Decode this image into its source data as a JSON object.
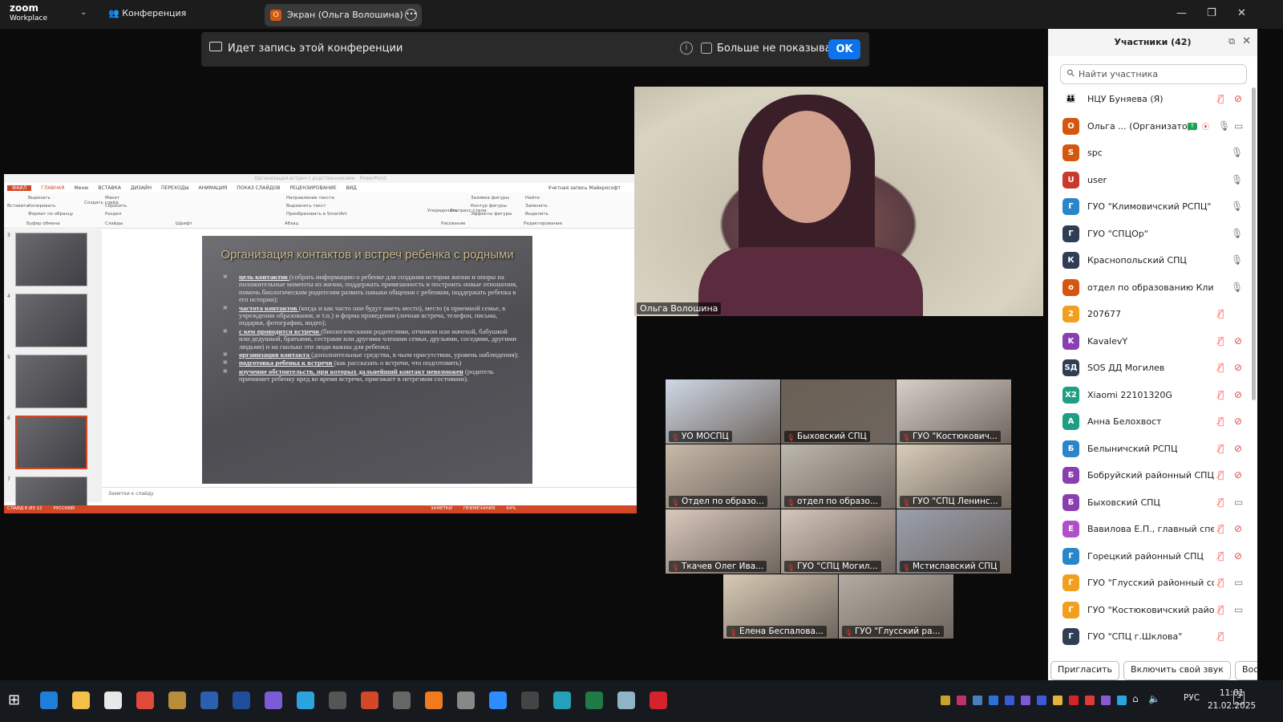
{
  "topbar": {
    "logo_line1": "zoom",
    "logo_line2": "Workplace",
    "meeting_menu": "Конференция",
    "screen_tab": "Экран (Ольга Волошина)",
    "screen_tab_initial": "О"
  },
  "banner": {
    "text": "Идет запись этой конференции",
    "dont_show": "Больше не показывать",
    "ok": "OK"
  },
  "ppt": {
    "window_title": "Организация встреч с родственниками - PowerPoint",
    "tabs": [
      "ФАЙЛ",
      "ГЛАВНАЯ",
      "Меню",
      "ВСТАВКА",
      "ДИЗАЙН",
      "ПЕРЕХОДЫ",
      "АНИМАЦИЯ",
      "ПОКАЗ СЛАЙДОВ",
      "РЕЦЕНЗИРОВАНИЕ",
      "ВИД"
    ],
    "account": "Учетная запись Майкрософт",
    "ribbon": [
      "Вставить",
      "Вырезать",
      "Копировать",
      "Формат по образцу",
      "Буфер обмена",
      "Создать слайд",
      "Макет",
      "Сбросить",
      "Раздел",
      "Слайды",
      "Шрифт",
      "Абзац",
      "Направление текста",
      "Выровнять текст",
      "Преобразовать в SmartArt",
      "Упорядочить",
      "Экспресс-стили",
      "Заливка фигуры",
      "Контур фигуры",
      "Эффекты фигуры",
      "Рисование",
      "Найти",
      "Заменить",
      "Выделить",
      "Редактирование"
    ],
    "thumb_numbers": [
      "3",
      "4",
      "5",
      "6",
      "7"
    ],
    "selected_slide": 6,
    "slide": {
      "title": "Организация контактов и встреч ребенка с родными",
      "bullets": [
        {
          "lead": "цель контактов ",
          "text": "(собрать информацию о ребенке для создания истории жизни и опоры на положительные моменты из жизни, поддержать привязанность и построить новые отношения, помочь биологическим родителям развить навыки общения с ребенком, поддержать ребенка в его истории);"
        },
        {
          "lead": "частота контактов ",
          "text": "(когда и как часто они будут иметь место), место (в приемной семье, в учреждении образования, и т.п.) и форма проведения (личная встреча, телефон, письма, подарки, фотографии, видео);"
        },
        {
          "lead": "с кем проводятся встречи ",
          "text": "(биологическими родителями, отчимом или мачехой, бабушкой или дедушкой, братьями, сестрами или другими членами семьи, друзьями, соседями, другими людьми) и на сколько эти люди важны для ребенка;"
        },
        {
          "lead": "организация контакта ",
          "text": "(дополнительные средства, в чьем присутствии, уровень наблюдения);"
        },
        {
          "lead": "подготовка ребенка к встречи ",
          "text": "(как рассказать о встречи, что подготовить)"
        },
        {
          "lead": "изучение обстоятельств, при которых дальнейший контакт невозможен",
          "text": " (родитель причиняет ребенку вред во время встречи, приезжает в нетрезвом состоянии)."
        }
      ]
    },
    "notes_placeholder": "Заметки к слайду",
    "status": [
      "СЛАЙД 6 ИЗ 12",
      "РУССКИЙ",
      "ЗАМЕТКИ",
      "ПРИМЕЧАНИЯ",
      "64%"
    ]
  },
  "main_video": {
    "name": "Ольга Волошина"
  },
  "gallery": [
    "УО МОСПЦ",
    "Быховский СПЦ",
    "ГУО \"Костюкович...",
    "Отдел по образо...",
    "отдел по образо...",
    "ГУО \"СПЦ Ленинс...",
    "Ткачев Олег Ива...",
    "ГУО \"СПЦ Могил...",
    "Мстиславский СПЦ",
    "Елена Беспалова...",
    "ГУО \"Глусский ра..."
  ],
  "participants": {
    "title": "Участники (42)",
    "search_placeholder": "Найти участника",
    "items": [
      {
        "name": "НЦУ Буняева (Я)",
        "initial": "",
        "color": "#2a6fb8",
        "mic": "muted",
        "video": "off"
      },
      {
        "name": "Ольга ...  (Организатор)",
        "initial": "О",
        "color": "#d4570f",
        "mic": "on",
        "video": "on",
        "host": true
      },
      {
        "name": "spc",
        "initial": "S",
        "color": "#d4570f",
        "mic": "on",
        "video": ""
      },
      {
        "name": "user",
        "initial": "U",
        "color": "#c93a2e",
        "mic": "on",
        "video": ""
      },
      {
        "name": "ГУО \"Климовичский РСПЦ\"",
        "initial": "Г",
        "color": "#2a86c8",
        "mic": "on",
        "video": ""
      },
      {
        "name": "ГУО \"СПЦОр\"",
        "initial": "Г",
        "color": "#2f3e55",
        "mic": "on",
        "video": ""
      },
      {
        "name": "Краснопольский СПЦ",
        "initial": "К",
        "color": "#2f3e55",
        "mic": "on",
        "video": ""
      },
      {
        "name": "отдел по образованию Климович...",
        "initial": "о",
        "color": "#d4570f",
        "mic": "on",
        "video": ""
      },
      {
        "name": "207677",
        "initial": "2",
        "color": "#f0a01e",
        "mic": "muted",
        "video": ""
      },
      {
        "name": "KavalevY",
        "initial": "K",
        "color": "#8a3fb0",
        "mic": "muted",
        "video": "off"
      },
      {
        "name": "SOS ДД Могилев",
        "initial": "SД",
        "color": "#2f3e55",
        "mic": "muted",
        "video": "off"
      },
      {
        "name": "Xiaomi 22101320G",
        "initial": "X2",
        "color": "#1e9e82",
        "mic": "muted",
        "video": "off"
      },
      {
        "name": "Анна Белохвост",
        "initial": "А",
        "color": "#1e9e82",
        "mic": "muted",
        "video": "off"
      },
      {
        "name": "Белыничский РСПЦ",
        "initial": "Б",
        "color": "#2a86c8",
        "mic": "muted",
        "video": "off"
      },
      {
        "name": "Бобруйский районный СПЦ",
        "initial": "Б",
        "color": "#8a3fb0",
        "mic": "muted",
        "video": "off"
      },
      {
        "name": "Быховский СПЦ",
        "initial": "Б",
        "color": "#8a3fb0",
        "mic": "muted",
        "video": "on"
      },
      {
        "name": "Вавилова Е.П., главный специ...",
        "initial": "Е",
        "color": "#b050c8",
        "mic": "muted",
        "video": "off"
      },
      {
        "name": "Горецкий районный СПЦ",
        "initial": "Г",
        "color": "#2a86c8",
        "mic": "muted",
        "video": "off"
      },
      {
        "name": "ГУО \"Глусский районный соци...",
        "initial": "Г",
        "color": "#f0a01e",
        "mic": "muted",
        "video": "on"
      },
      {
        "name": "ГУО \"Костюковичский районн...",
        "initial": "Г",
        "color": "#f0a01e",
        "mic": "muted",
        "video": "on"
      },
      {
        "name": "ГУО \"СПЦ г.Шклова\"",
        "initial": "Г",
        "color": "#2f3e55",
        "mic": "muted",
        "video": ""
      }
    ],
    "buttons": [
      "Пригласить",
      "Включить свой звук",
      "Восстановить"
    ]
  },
  "taskbar": {
    "apps": [
      {
        "icon": "windows-icon",
        "color": "#3a8ee6"
      },
      {
        "icon": "edge-icon",
        "color": "#1e7fd8"
      },
      {
        "icon": "file-explorer-icon",
        "color": "#f3c14a"
      },
      {
        "icon": "store-icon",
        "color": "#e8e8e8"
      },
      {
        "icon": "chrome-icon",
        "color": "#e04a3a"
      },
      {
        "icon": "app-icon",
        "color": "#b98c3c"
      },
      {
        "icon": "word-icon",
        "color": "#2b5fb0"
      },
      {
        "icon": "word-alt-icon",
        "color": "#1f4d9c"
      },
      {
        "icon": "viber-icon",
        "color": "#7b5cd6"
      },
      {
        "icon": "telegram-icon",
        "color": "#2aa3df"
      },
      {
        "icon": "info-icon",
        "color": "#555"
      },
      {
        "icon": "powerpoint-icon",
        "color": "#d24726"
      },
      {
        "icon": "info-alt-icon",
        "color": "#666"
      },
      {
        "icon": "firefox-icon",
        "color": "#f07a1e"
      },
      {
        "icon": "media-icon",
        "color": "#888"
      },
      {
        "icon": "zoom-icon",
        "color": "#2d8cff"
      },
      {
        "icon": "obs-icon",
        "color": "#444"
      },
      {
        "icon": "globe-icon",
        "color": "#26a0b8"
      },
      {
        "icon": "excel-icon",
        "color": "#1f7a45"
      },
      {
        "icon": "paint-icon",
        "color": "#8fb3c7"
      },
      {
        "icon": "acrobat-icon",
        "color": "#d4232b"
      }
    ],
    "tray": [
      "#c9a227",
      "#c0306a",
      "#4a7fbf",
      "#2a72d6",
      "#3a5ad6",
      "#7b5cd6",
      "#3a5ad6",
      "#e5b53a",
      "#d4232b",
      "#e03a3a",
      "#8a5ad6",
      "#2aa3df"
    ],
    "lang": "РУС",
    "time": "11:01",
    "date": "21.02.2025"
  }
}
